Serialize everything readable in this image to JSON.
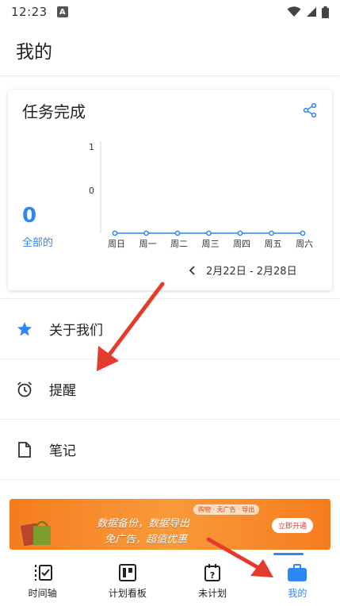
{
  "status": {
    "time": "12:23",
    "a_badge": "A"
  },
  "header": {
    "title": "我的"
  },
  "task_card": {
    "title": "任务完成",
    "count": "0",
    "count_label": "全部的",
    "week_range": "2月22日 - 2月28日"
  },
  "chart_data": {
    "type": "line",
    "categories": [
      "周日",
      "周一",
      "周二",
      "周三",
      "周四",
      "周五",
      "周六"
    ],
    "values": [
      0,
      0,
      0,
      0,
      0,
      0,
      0
    ],
    "y_ticks": [
      "1",
      "0"
    ],
    "grid": false,
    "color": "#2f86f6"
  },
  "menu": {
    "items": [
      {
        "label": "关于我们",
        "icon": "star-icon"
      },
      {
        "label": "提醒",
        "icon": "alarm-clock-icon"
      },
      {
        "label": "笔记",
        "icon": "note-icon"
      }
    ]
  },
  "ad": {
    "tags": "购物 · 无广告 · 导出",
    "line1": "数据备份，数据导出",
    "line2": "免广告，超值优惠",
    "cta": "立即开通"
  },
  "bottom_nav": {
    "items": [
      {
        "label": "时间轴",
        "icon": "timeline-icon"
      },
      {
        "label": "计划看板",
        "icon": "board-icon"
      },
      {
        "label": "未计划",
        "icon": "unplanned-icon"
      },
      {
        "label": "我的",
        "icon": "briefcase-icon"
      }
    ]
  },
  "colors": {
    "accent": "#2f86f6",
    "annotation_arrow": "#e53b2c",
    "ad_orange": "#f57c1f"
  }
}
